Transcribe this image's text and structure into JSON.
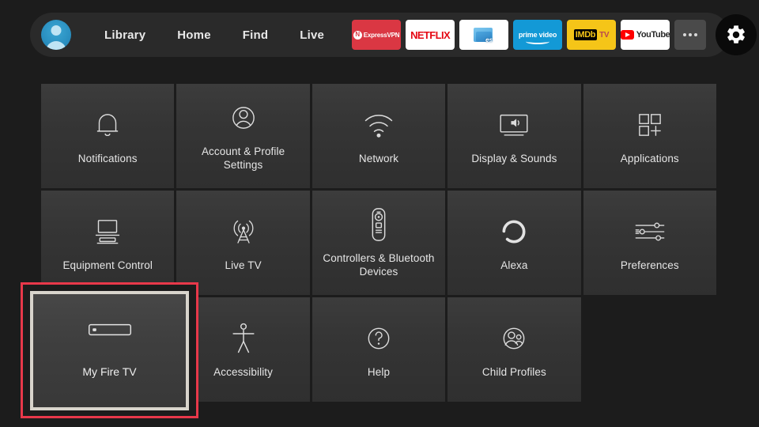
{
  "nav": {
    "avatar_name": "profile-avatar",
    "links": [
      {
        "label": "Library"
      },
      {
        "label": "Home"
      },
      {
        "label": "Find"
      },
      {
        "label": "Live"
      }
    ],
    "apps": [
      {
        "name": "expressvpn",
        "label": "ExpressVPN",
        "badge": "N",
        "color": "#da3743"
      },
      {
        "name": "netflix",
        "label": "NETFLIX",
        "color": "#e50914"
      },
      {
        "name": "es-file-explorer",
        "label": "es",
        "color": "#3f9bd8"
      },
      {
        "name": "prime-video",
        "label": "prime video",
        "color": "#1399d6"
      },
      {
        "name": "imdb-tv",
        "label": "IMDb",
        "label2": "TV",
        "color": "#f5c518"
      },
      {
        "name": "youtube",
        "label": "YouTube",
        "color": "#ff0000"
      }
    ],
    "more_label": "•••",
    "gear_label": "Settings"
  },
  "grid": {
    "tiles": [
      {
        "id": "notifications",
        "label": "Notifications",
        "icon": "bell-icon"
      },
      {
        "id": "account",
        "label": "Account & Profile Settings",
        "icon": "user-circle-icon"
      },
      {
        "id": "network",
        "label": "Network",
        "icon": "wifi-icon"
      },
      {
        "id": "display",
        "label": "Display & Sounds",
        "icon": "display-sound-icon"
      },
      {
        "id": "applications",
        "label": "Applications",
        "icon": "app-grid-icon"
      },
      {
        "id": "equipment",
        "label": "Equipment Control",
        "icon": "equipment-icon"
      },
      {
        "id": "livetv",
        "label": "Live TV",
        "icon": "antenna-icon"
      },
      {
        "id": "controllers",
        "label": "Controllers & Bluetooth Devices",
        "icon": "remote-icon"
      },
      {
        "id": "alexa",
        "label": "Alexa",
        "icon": "alexa-ring-icon"
      },
      {
        "id": "preferences",
        "label": "Preferences",
        "icon": "sliders-icon"
      },
      {
        "id": "accessibility",
        "label": "Accessibility",
        "icon": "accessibility-icon"
      },
      {
        "id": "help",
        "label": "Help",
        "icon": "question-circle-icon"
      },
      {
        "id": "childprofiles",
        "label": "Child Profiles",
        "icon": "child-profiles-icon"
      }
    ],
    "selected": {
      "id": "my-fire-tv",
      "label": "My Fire TV",
      "icon": "firestick-icon",
      "highlight_color": "#e8384a",
      "focus_border_color": "#d8d4cc"
    }
  },
  "theme": {
    "background": "#1c1c1c",
    "topbar_background": "#2a2a2a",
    "tile_background": "#383838",
    "text": "#e6e6e6"
  }
}
